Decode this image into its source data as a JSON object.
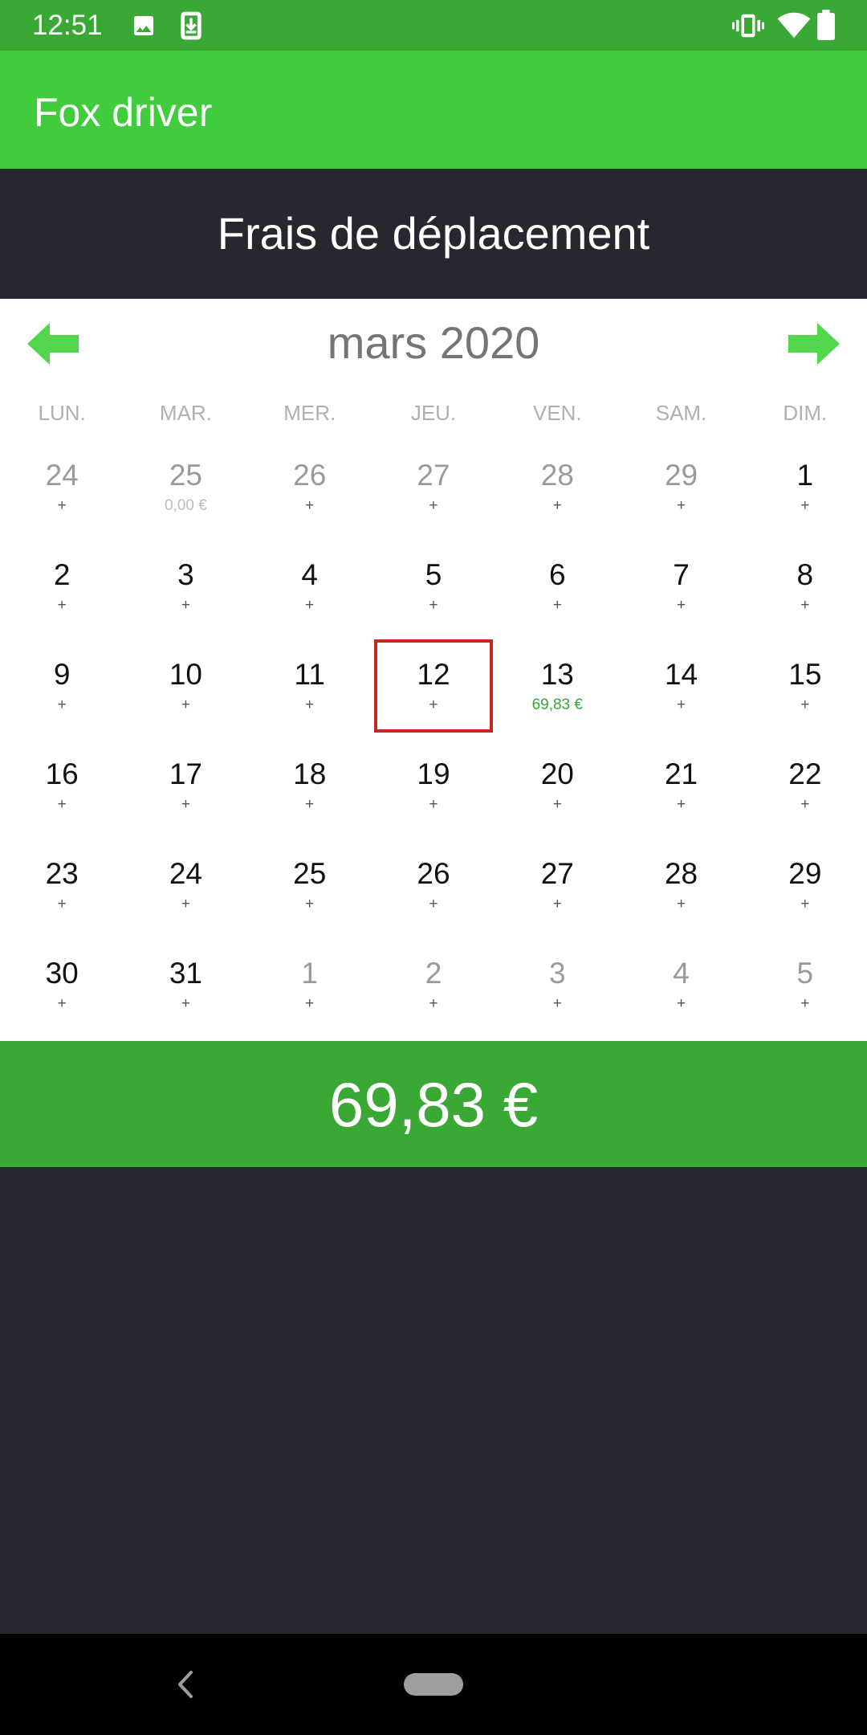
{
  "status_bar": {
    "time": "12:51",
    "left_icons": [
      "image-icon",
      "download-icon"
    ],
    "right_icons": [
      "vibrate-icon",
      "wifi-icon",
      "battery-icon"
    ]
  },
  "app_bar": {
    "title": "Fox driver"
  },
  "header": {
    "title": "Frais de déplacement"
  },
  "calendar": {
    "month_label": "mars 2020",
    "prev_icon": "arrow-left-icon",
    "next_icon": "arrow-right-icon",
    "weekdays": [
      "LUN.",
      "MAR.",
      "MER.",
      "JEU.",
      "VEN.",
      "SAM.",
      "DIM."
    ],
    "weeks": [
      [
        {
          "day": "24",
          "sub": "+",
          "other": true
        },
        {
          "day": "25",
          "sub": "0,00 €",
          "other": true
        },
        {
          "day": "26",
          "sub": "+",
          "other": true
        },
        {
          "day": "27",
          "sub": "+",
          "other": true
        },
        {
          "day": "28",
          "sub": "+",
          "other": true
        },
        {
          "day": "29",
          "sub": "+",
          "other": true
        },
        {
          "day": "1",
          "sub": "+"
        }
      ],
      [
        {
          "day": "2",
          "sub": "+"
        },
        {
          "day": "3",
          "sub": "+"
        },
        {
          "day": "4",
          "sub": "+"
        },
        {
          "day": "5",
          "sub": "+"
        },
        {
          "day": "6",
          "sub": "+"
        },
        {
          "day": "7",
          "sub": "+"
        },
        {
          "day": "8",
          "sub": "+"
        }
      ],
      [
        {
          "day": "9",
          "sub": "+"
        },
        {
          "day": "10",
          "sub": "+"
        },
        {
          "day": "11",
          "sub": "+"
        },
        {
          "day": "12",
          "sub": "+",
          "selected": true
        },
        {
          "day": "13",
          "sub": "69,83 €"
        },
        {
          "day": "14",
          "sub": "+"
        },
        {
          "day": "15",
          "sub": "+"
        }
      ],
      [
        {
          "day": "16",
          "sub": "+"
        },
        {
          "day": "17",
          "sub": "+"
        },
        {
          "day": "18",
          "sub": "+"
        },
        {
          "day": "19",
          "sub": "+"
        },
        {
          "day": "20",
          "sub": "+"
        },
        {
          "day": "21",
          "sub": "+"
        },
        {
          "day": "22",
          "sub": "+"
        }
      ],
      [
        {
          "day": "23",
          "sub": "+"
        },
        {
          "day": "24",
          "sub": "+"
        },
        {
          "day": "25",
          "sub": "+"
        },
        {
          "day": "26",
          "sub": "+"
        },
        {
          "day": "27",
          "sub": "+"
        },
        {
          "day": "28",
          "sub": "+"
        },
        {
          "day": "29",
          "sub": "+"
        }
      ],
      [
        {
          "day": "30",
          "sub": "+"
        },
        {
          "day": "31",
          "sub": "+"
        },
        {
          "day": "1",
          "sub": "+",
          "other": true
        },
        {
          "day": "2",
          "sub": "+",
          "other": true
        },
        {
          "day": "3",
          "sub": "+",
          "other": true
        },
        {
          "day": "4",
          "sub": "+",
          "other": true
        },
        {
          "day": "5",
          "sub": "+",
          "other": true
        }
      ]
    ]
  },
  "total": {
    "value": "69,83 €"
  },
  "nav_bar": {
    "back_icon": "back-icon",
    "home_icon": "home-pill-icon"
  },
  "colors": {
    "status_bar": "#39a835",
    "app_bar": "#41cc3e",
    "header": "#272730",
    "total_bar": "#39a835",
    "selected_border": "#c62828",
    "amount_text": "#36a832"
  }
}
